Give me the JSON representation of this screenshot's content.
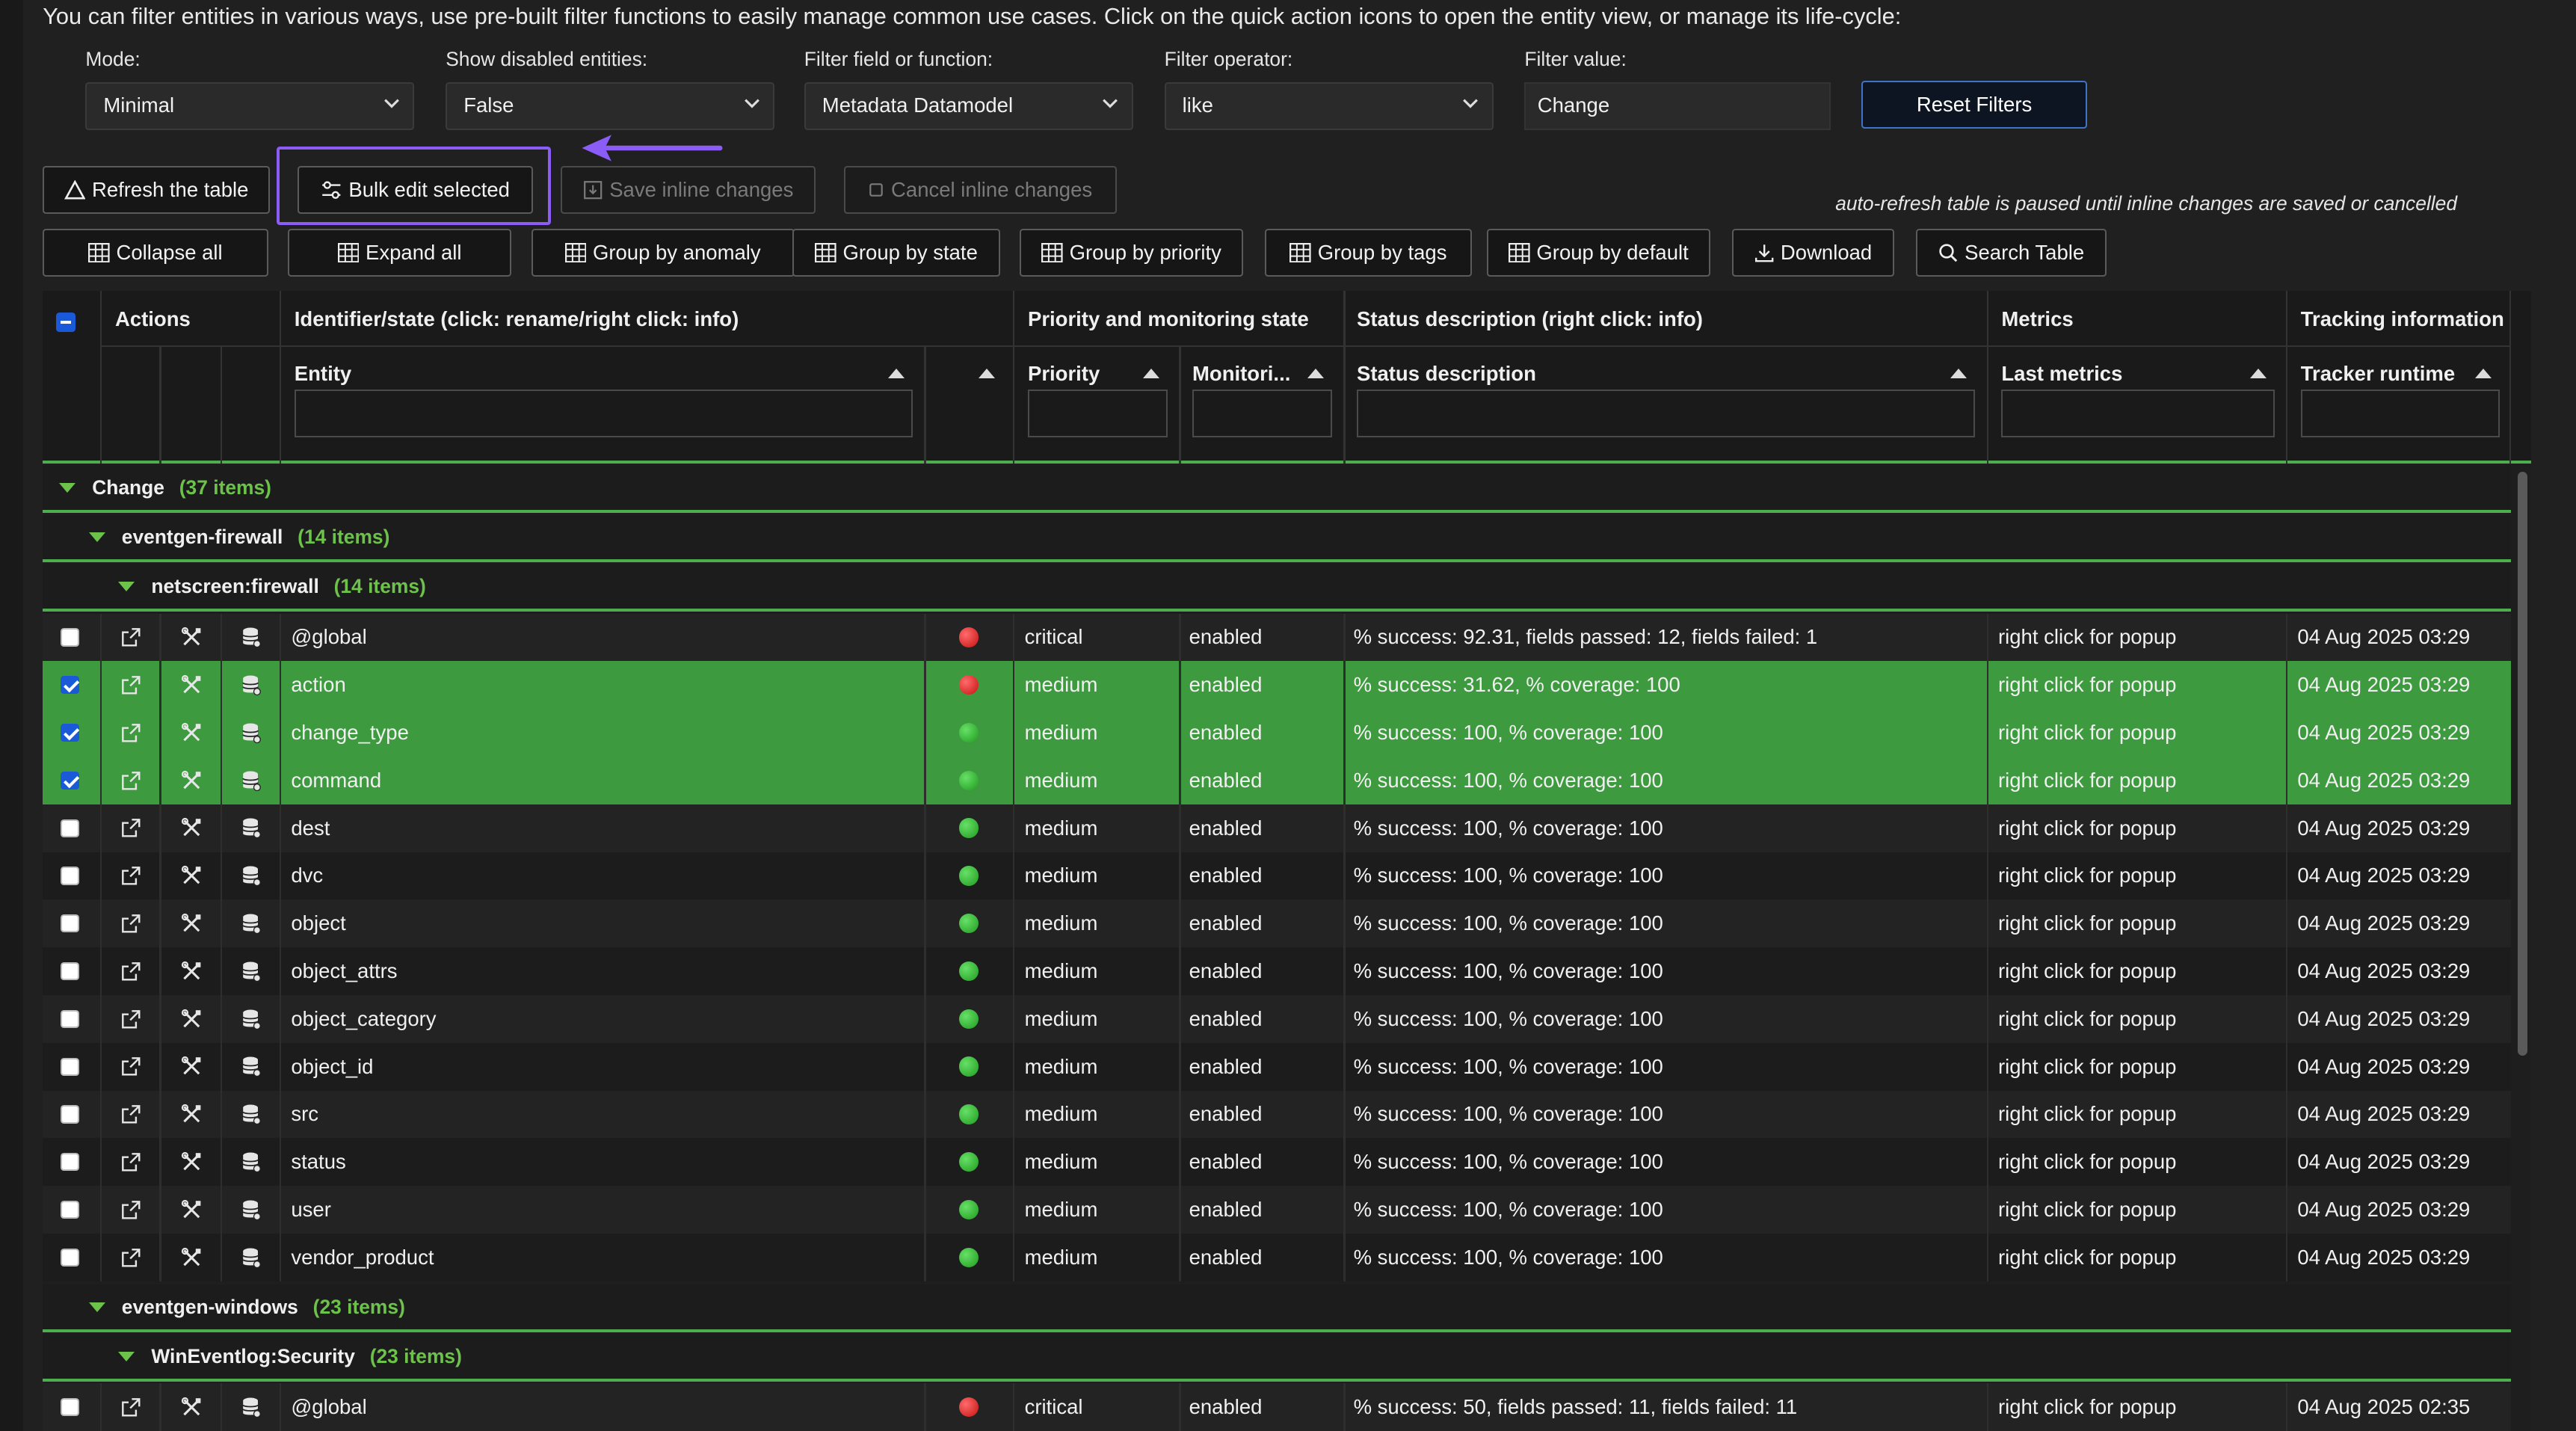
{
  "intro": "You can filter entities in various ways, use pre-built filter functions to easily manage common use cases. Click on the quick action icons to open the entity view, or manage its life-cycle:",
  "filters": {
    "mode": {
      "label": "Mode:",
      "value": "Minimal"
    },
    "disabled": {
      "label": "Show disabled entities:",
      "value": "False"
    },
    "field": {
      "label": "Filter field or function:",
      "value": "Metadata Datamodel"
    },
    "operator": {
      "label": "Filter operator:",
      "value": "like"
    },
    "value": {
      "label": "Filter value:",
      "value": "Change"
    },
    "reset": "Reset Filters"
  },
  "toolbar1": {
    "refresh": "Refresh the table",
    "bulk": "Bulk edit selected",
    "save": "Save inline changes",
    "cancel": "Cancel inline changes",
    "note": "auto-refresh table is paused until inline changes are saved or cancelled"
  },
  "toolbar2": {
    "collapse": "Collapse all",
    "expand": "Expand all",
    "anomaly": "Group by anomaly",
    "state": "Group by state",
    "priority": "Group by priority",
    "tags": "Group by tags",
    "default": "Group by default",
    "download": "Download",
    "search": "Search Table"
  },
  "table": {
    "groups": {
      "actions": "Actions",
      "identifier": "Identifier/state (click: rename/right click: info)",
      "priority": "Priority and monitoring state",
      "status": "Status description (right click: info)",
      "metrics": "Metrics",
      "tracking": "Tracking information"
    },
    "columns": {
      "entity": "Entity",
      "priority": "Priority",
      "monitoring": "Monitori...",
      "status": "Status description",
      "metrics": "Last metrics",
      "runtime": "Tracker runtime"
    },
    "g1": {
      "name": "Change",
      "count": "(37 items)"
    },
    "g2": {
      "name": "eventgen-firewall",
      "count": "(14 items)"
    },
    "g3": {
      "name": "netscreen:firewall",
      "count": "(14 items)"
    },
    "g4": {
      "name": "eventgen-windows",
      "count": "(23 items)"
    },
    "g5": {
      "name": "WinEventlog:Security",
      "count": "(23 items)"
    },
    "rows": [
      {
        "checked": false,
        "state": "red",
        "entity": "@global",
        "priority": "critical",
        "monitoring": "enabled",
        "status": "% success: 92.31, fields passed: 12, fields failed: 1",
        "metrics": "right click for popup",
        "runtime": "04 Aug 2025 03:29"
      },
      {
        "checked": true,
        "state": "red",
        "entity": "action",
        "priority": "medium",
        "monitoring": "enabled",
        "status": "% success: 31.62, % coverage: 100",
        "metrics": "right click for popup",
        "runtime": "04 Aug 2025 03:29"
      },
      {
        "checked": true,
        "state": "green",
        "entity": "change_type",
        "priority": "medium",
        "monitoring": "enabled",
        "status": "% success: 100, % coverage: 100",
        "metrics": "right click for popup",
        "runtime": "04 Aug 2025 03:29"
      },
      {
        "checked": true,
        "state": "green",
        "entity": "command",
        "priority": "medium",
        "monitoring": "enabled",
        "status": "% success: 100, % coverage: 100",
        "metrics": "right click for popup",
        "runtime": "04 Aug 2025 03:29"
      },
      {
        "checked": false,
        "state": "green",
        "entity": "dest",
        "priority": "medium",
        "monitoring": "enabled",
        "status": "% success: 100, % coverage: 100",
        "metrics": "right click for popup",
        "runtime": "04 Aug 2025 03:29"
      },
      {
        "checked": false,
        "state": "green",
        "entity": "dvc",
        "priority": "medium",
        "monitoring": "enabled",
        "status": "% success: 100, % coverage: 100",
        "metrics": "right click for popup",
        "runtime": "04 Aug 2025 03:29"
      },
      {
        "checked": false,
        "state": "green",
        "entity": "object",
        "priority": "medium",
        "monitoring": "enabled",
        "status": "% success: 100, % coverage: 100",
        "metrics": "right click for popup",
        "runtime": "04 Aug 2025 03:29"
      },
      {
        "checked": false,
        "state": "green",
        "entity": "object_attrs",
        "priority": "medium",
        "monitoring": "enabled",
        "status": "% success: 100, % coverage: 100",
        "metrics": "right click for popup",
        "runtime": "04 Aug 2025 03:29"
      },
      {
        "checked": false,
        "state": "green",
        "entity": "object_category",
        "priority": "medium",
        "monitoring": "enabled",
        "status": "% success: 100, % coverage: 100",
        "metrics": "right click for popup",
        "runtime": "04 Aug 2025 03:29"
      },
      {
        "checked": false,
        "state": "green",
        "entity": "object_id",
        "priority": "medium",
        "monitoring": "enabled",
        "status": "% success: 100, % coverage: 100",
        "metrics": "right click for popup",
        "runtime": "04 Aug 2025 03:29"
      },
      {
        "checked": false,
        "state": "green",
        "entity": "src",
        "priority": "medium",
        "monitoring": "enabled",
        "status": "% success: 100, % coverage: 100",
        "metrics": "right click for popup",
        "runtime": "04 Aug 2025 03:29"
      },
      {
        "checked": false,
        "state": "green",
        "entity": "status",
        "priority": "medium",
        "monitoring": "enabled",
        "status": "% success: 100, % coverage: 100",
        "metrics": "right click for popup",
        "runtime": "04 Aug 2025 03:29"
      },
      {
        "checked": false,
        "state": "green",
        "entity": "user",
        "priority": "medium",
        "monitoring": "enabled",
        "status": "% success: 100, % coverage: 100",
        "metrics": "right click for popup",
        "runtime": "04 Aug 2025 03:29"
      },
      {
        "checked": false,
        "state": "green",
        "entity": "vendor_product",
        "priority": "medium",
        "monitoring": "enabled",
        "status": "% success: 100, % coverage: 100",
        "metrics": "right click for popup",
        "runtime": "04 Aug 2025 03:29"
      }
    ],
    "lastRow": {
      "checked": false,
      "state": "red",
      "entity": "@global",
      "priority": "critical",
      "monitoring": "enabled",
      "status": "% success: 50, fields passed: 11, fields failed: 11",
      "metrics": "right click for popup",
      "runtime": "04 Aug 2025 02:35"
    }
  }
}
